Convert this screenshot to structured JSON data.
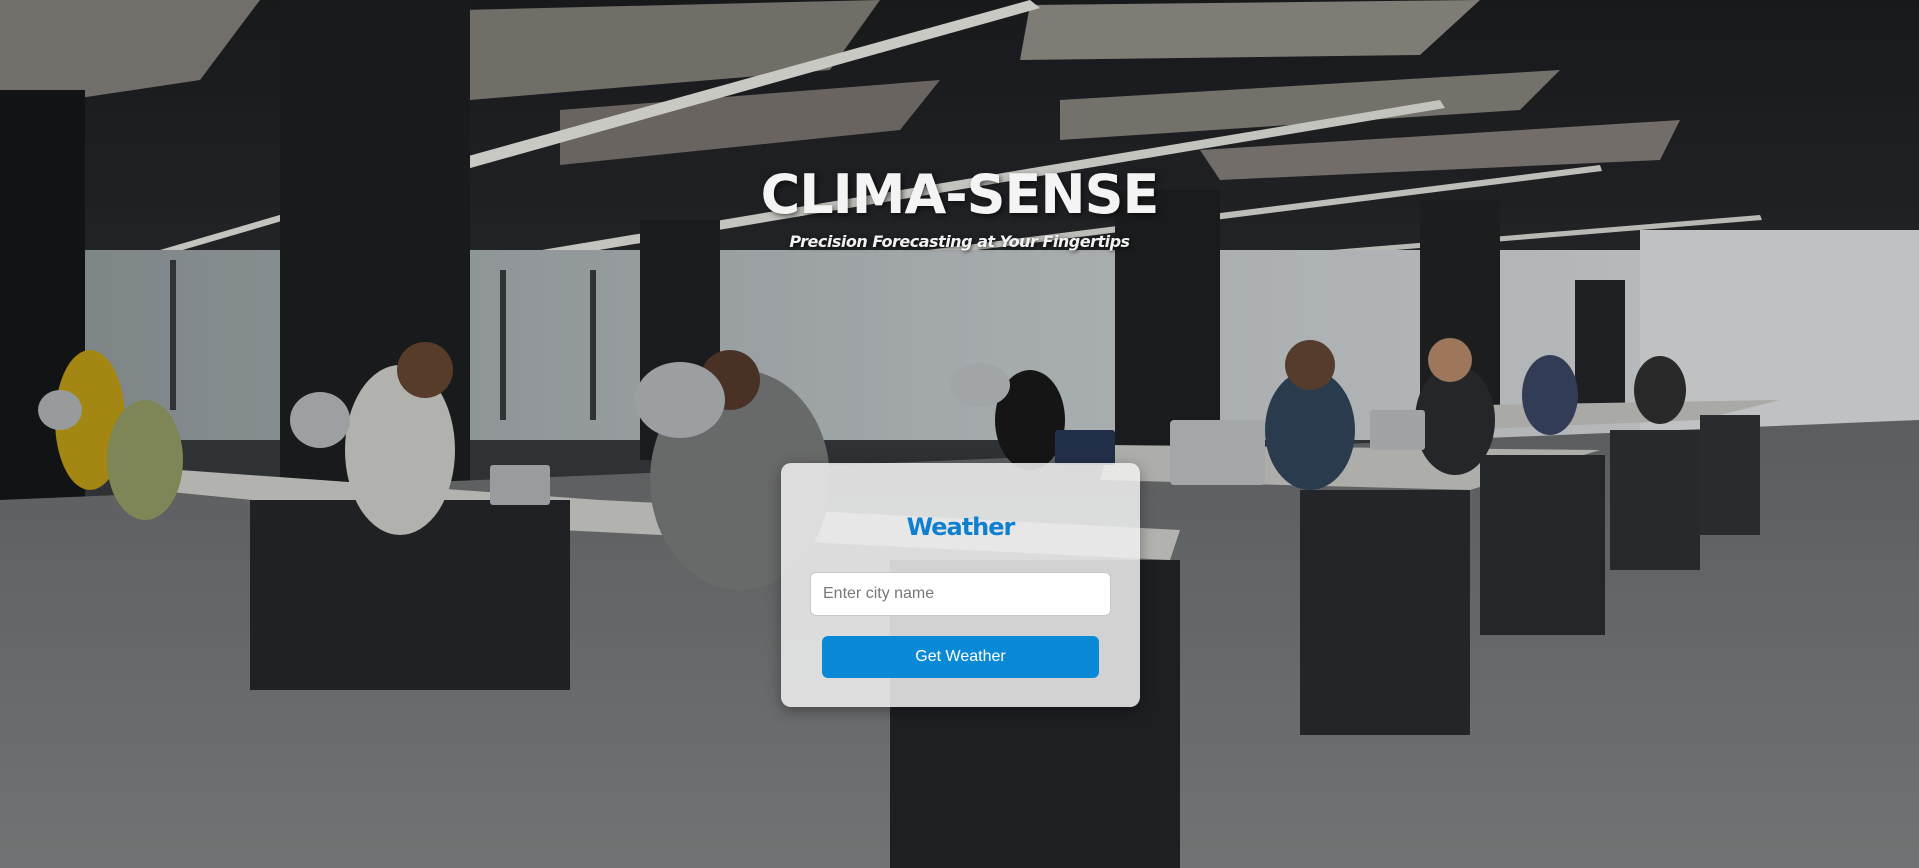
{
  "header": {
    "title": "CLIMA-SENSE",
    "tagline": "Precision Forecasting at Your Fingertips"
  },
  "weather_card": {
    "heading": "Weather",
    "city_input": {
      "value": "",
      "placeholder": "Enter city name"
    },
    "submit_label": "Get Weather"
  },
  "colors": {
    "accent": "#0a8ad6",
    "heading": "#0f7fd0",
    "title_text": "#f4f4f4"
  },
  "background_image": "open-plan office with people working at laptops"
}
